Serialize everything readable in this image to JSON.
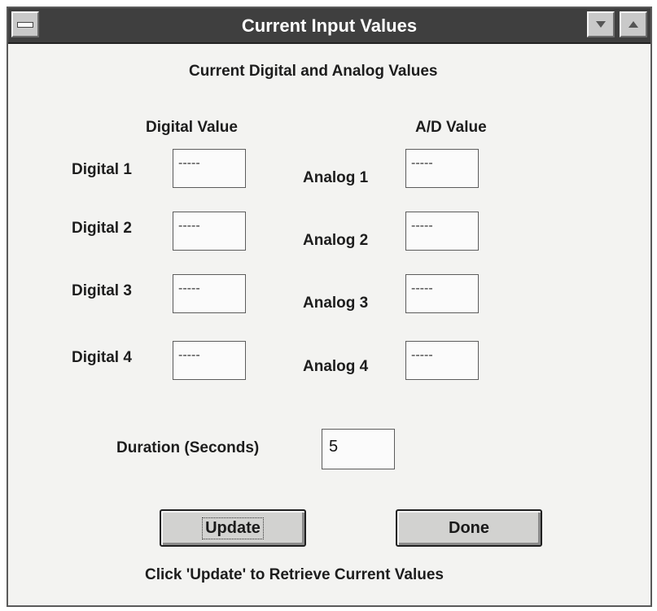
{
  "window": {
    "title": "Current Input Values"
  },
  "header": {
    "subtitle": "Current Digital and Analog Values"
  },
  "columns": {
    "digital_header": "Digital Value",
    "analog_header": "A/D Value"
  },
  "digital": [
    {
      "label": "Digital 1",
      "value": "-----"
    },
    {
      "label": "Digital 2",
      "value": "-----"
    },
    {
      "label": "Digital 3",
      "value": "-----"
    },
    {
      "label": "Digital 4",
      "value": "-----"
    }
  ],
  "analog": [
    {
      "label": "Analog 1",
      "value": "-----"
    },
    {
      "label": "Analog 2",
      "value": "-----"
    },
    {
      "label": "Analog 3",
      "value": "-----"
    },
    {
      "label": "Analog 4",
      "value": "-----"
    }
  ],
  "duration": {
    "label": "Duration (Seconds)",
    "value": "5"
  },
  "buttons": {
    "update_label": "Update",
    "done_label": "Done"
  },
  "footer": {
    "hint": "Click 'Update' to Retrieve Current Values"
  },
  "icons": {
    "system_menu": "system-menu-icon",
    "minimize": "triangle-down-icon",
    "maximize": "triangle-up-icon"
  }
}
